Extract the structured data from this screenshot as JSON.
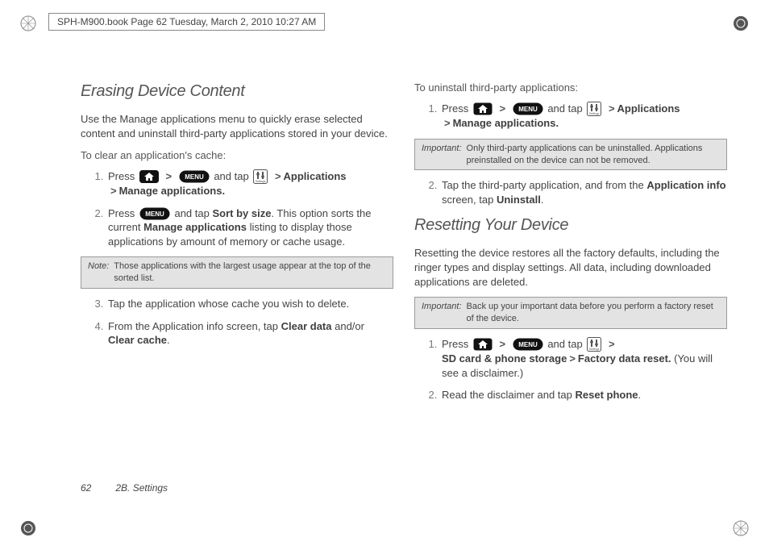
{
  "header": "SPH-M900.book  Page 62  Tuesday, March 2, 2010  10:27 AM",
  "left": {
    "h1": "Erasing Device Content",
    "intro": "Use the Manage applications menu to quickly erase selected content and uninstall third-party applications stored in your device.",
    "lead1": "To clear an application's cache:",
    "s1_a": "Press ",
    "s1_b": " and tap ",
    "s1_apps": "Applications",
    "s1_manage": "Manage applications.",
    "s2_a": "Press ",
    "s2_b": " and tap ",
    "s2_sort": "Sort by size",
    "s2_c": ". This option sorts the current ",
    "s2_manage": "Manage applications",
    "s2_d": " listing to display those applications by amount of memory or cache usage.",
    "note_label": "Note:",
    "note_text": "Those applications with the largest usage appear at the top of the sorted list.",
    "s3": "Tap the application whose cache you wish to delete.",
    "s4_a": "From the Application info screen, tap ",
    "s4_clear_data": "Clear data",
    "s4_b": " and/or ",
    "s4_clear_cache": "Clear cache",
    "s4_c": "."
  },
  "right": {
    "lead1": "To uninstall third-party applications:",
    "u1_a": "Press ",
    "u1_b": " and tap ",
    "u1_apps": "Applications",
    "u1_manage": "Manage applications.",
    "imp1_label": "Important:",
    "imp1_text": "Only third-party applications can be uninstalled. Applications preinstalled on the device can not be removed.",
    "u2_a": "Tap the third-party application, and from the ",
    "u2_appinfo": "Application info",
    "u2_b": " screen, tap ",
    "u2_uninstall": "Uninstall",
    "u2_c": ".",
    "h2": "Resetting Your Device",
    "intro2": "Resetting the device restores all the factory defaults, including the ringer types and display settings. All data, including downloaded applications are deleted.",
    "imp2_label": "Important:",
    "imp2_text": "Back up your important data before you perform a factory reset of the device.",
    "r1_a": "Press ",
    "r1_b": " and tap ",
    "r1_sd": "SD card & phone storage",
    "r1_fact": "Factory data reset.",
    "r1_c": " (You will see a disclaimer.)",
    "r2_a": "Read the disclaimer and tap ",
    "r2_reset": "Reset phone",
    "r2_b": "."
  },
  "footer": {
    "page": "62",
    "section": "2B. Settings"
  }
}
